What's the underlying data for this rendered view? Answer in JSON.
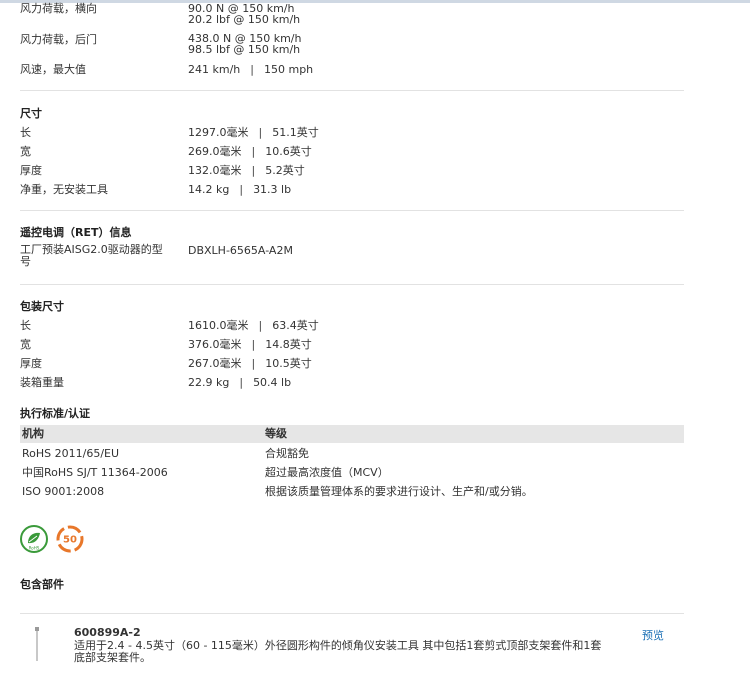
{
  "specs_top": [
    {
      "label": "风力荷载，横向",
      "line1": "90.0 N @ 150 km/h",
      "line2": "20.2 lbf @ 150 km/h"
    },
    {
      "label": "风力荷载，后门",
      "line1": "438.0 N @ 150 km/h",
      "line2": "98.5 lbf @ 150 km/h"
    },
    {
      "label": "风速，最大值",
      "metric": "241 km/h",
      "imperial": "150 mph"
    }
  ],
  "dimensions": {
    "title": "尺寸",
    "rows": [
      {
        "label": "长",
        "metric": "1297.0毫米",
        "imperial": "51.1英寸"
      },
      {
        "label": "宽",
        "metric": "269.0毫米",
        "imperial": "10.6英寸"
      },
      {
        "label": "厚度",
        "metric": "132.0毫米",
        "imperial": "5.2英寸"
      },
      {
        "label": "净重，无安装工具",
        "metric": "14.2 kg",
        "imperial": "31.3 lb"
      }
    ]
  },
  "ret": {
    "title": "遥控电调（RET）信息",
    "label_line1": "工厂预装AISG2.0驱动器的型",
    "label_line2": "号",
    "value": "DBXLH-6565A-A2M"
  },
  "packaging": {
    "title": "包装尺寸",
    "rows": [
      {
        "label": "长",
        "metric": "1610.0毫米",
        "imperial": "63.4英寸"
      },
      {
        "label": "宽",
        "metric": "376.0毫米",
        "imperial": "14.8英寸"
      },
      {
        "label": "厚度",
        "metric": "267.0毫米",
        "imperial": "10.5英寸"
      },
      {
        "label": "装箱重量",
        "metric": "22.9 kg",
        "imperial": "50.4 lb"
      }
    ]
  },
  "standards": {
    "title": "执行标准/认证",
    "col1": "机构",
    "col2": "等级",
    "rows": [
      {
        "agency": "RoHS 2011/65/EU",
        "level": "合规豁免"
      },
      {
        "agency": "中国RoHS SJ/T 11364-2006",
        "level": "超过最高浓度值（MCV）"
      },
      {
        "agency": "ISO 9001:2008",
        "level": "根据该质量管理体系的要求进行设计、生产和/或分销。"
      }
    ]
  },
  "badges": {
    "rohs_color": "#3a9a3a",
    "china_rohs_color": "#e8772a",
    "china_rohs_number": "50",
    "rohs_text": "RoHS"
  },
  "included": {
    "title": "包含部件",
    "part_number": "600899A-2",
    "description_line1": "适用于2.4 - 4.5英寸（60 - 115毫米）外径圆形构件的倾角仪安装工具 其中包括1套剪式顶部支架套件和1套",
    "description_line2": "底部支架套件。",
    "preview": "预览"
  },
  "separator": "|"
}
